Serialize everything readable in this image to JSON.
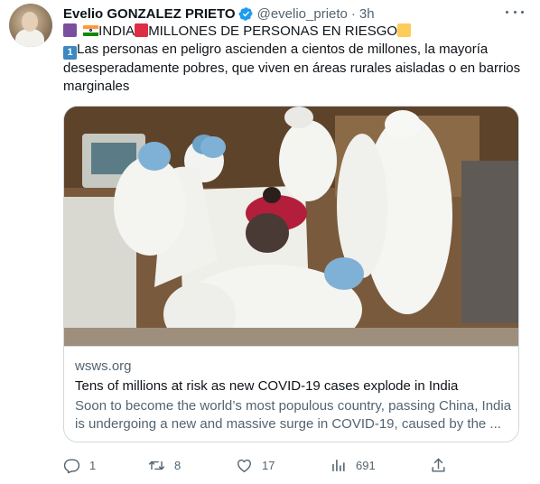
{
  "tweet": {
    "author_name": "Evelio GONZALEZ PRIETO",
    "handle": "@evelio_prieto",
    "separator": "·",
    "time": "3h",
    "line1_a": "INDIA",
    "line1_b": "MILLONES DE PERSONAS EN RIESGO",
    "keycap": "1",
    "line2": "Las personas en peligro ascienden a cientos de millones, la mayoría",
    "line3": "desesperadamente pobres, que viven en áreas rurales aisladas o en barrios",
    "line4": "marginales"
  },
  "card": {
    "domain": "wsws.org",
    "title": "Tens of millions at risk as new COVID-19 cases explode in India",
    "desc_line1": "Soon to become the world’s most populous country, passing China, India",
    "desc_line2": "is undergoing a new and massive surge in COVID-19, caused by the ..."
  },
  "actions": {
    "replies": "1",
    "retweets": "8",
    "likes": "17",
    "views": "691"
  },
  "colors": {
    "verified": "#1d9bf0",
    "secondary_text": "#536471",
    "border": "#cfd9de"
  },
  "icons": [
    "verified-badge-icon",
    "more-options-icon",
    "reply-icon",
    "retweet-icon",
    "like-icon",
    "views-icon",
    "share-icon"
  ]
}
